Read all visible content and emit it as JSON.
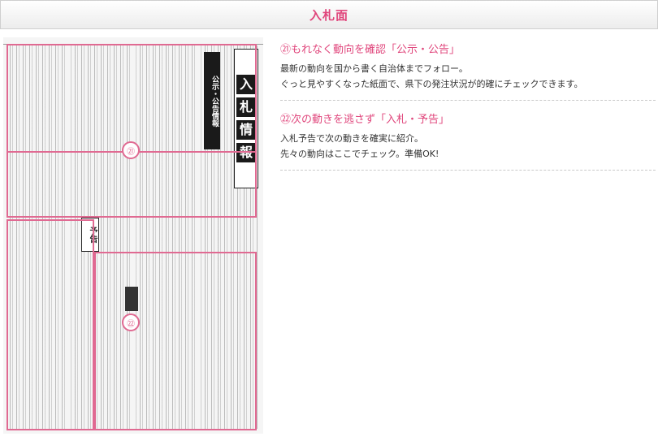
{
  "header": {
    "title": "入札面"
  },
  "paper": {
    "title_chars": [
      "入",
      "札",
      "情",
      "報"
    ],
    "subtitle": "公示・公告情報",
    "yokoku": "予告",
    "callouts": [
      "㉑",
      "㉒"
    ]
  },
  "sections": [
    {
      "title": "㉑もれなく動向を確認「公示・公告」",
      "lines": [
        "最新の動向を国から書く自治体までフォロー。",
        "ぐっと見やすくなった紙面で、県下の発注状況が的確にチェックできます。"
      ]
    },
    {
      "title": "㉒次の動きを逃さず「入札・予告」",
      "lines": [
        "入札予告で次の動きを確実に紹介。",
        "先々の動向はここでチェック。準備OK!"
      ]
    }
  ],
  "colors": {
    "accent": "#e0467c",
    "outline": "#e06a92"
  }
}
